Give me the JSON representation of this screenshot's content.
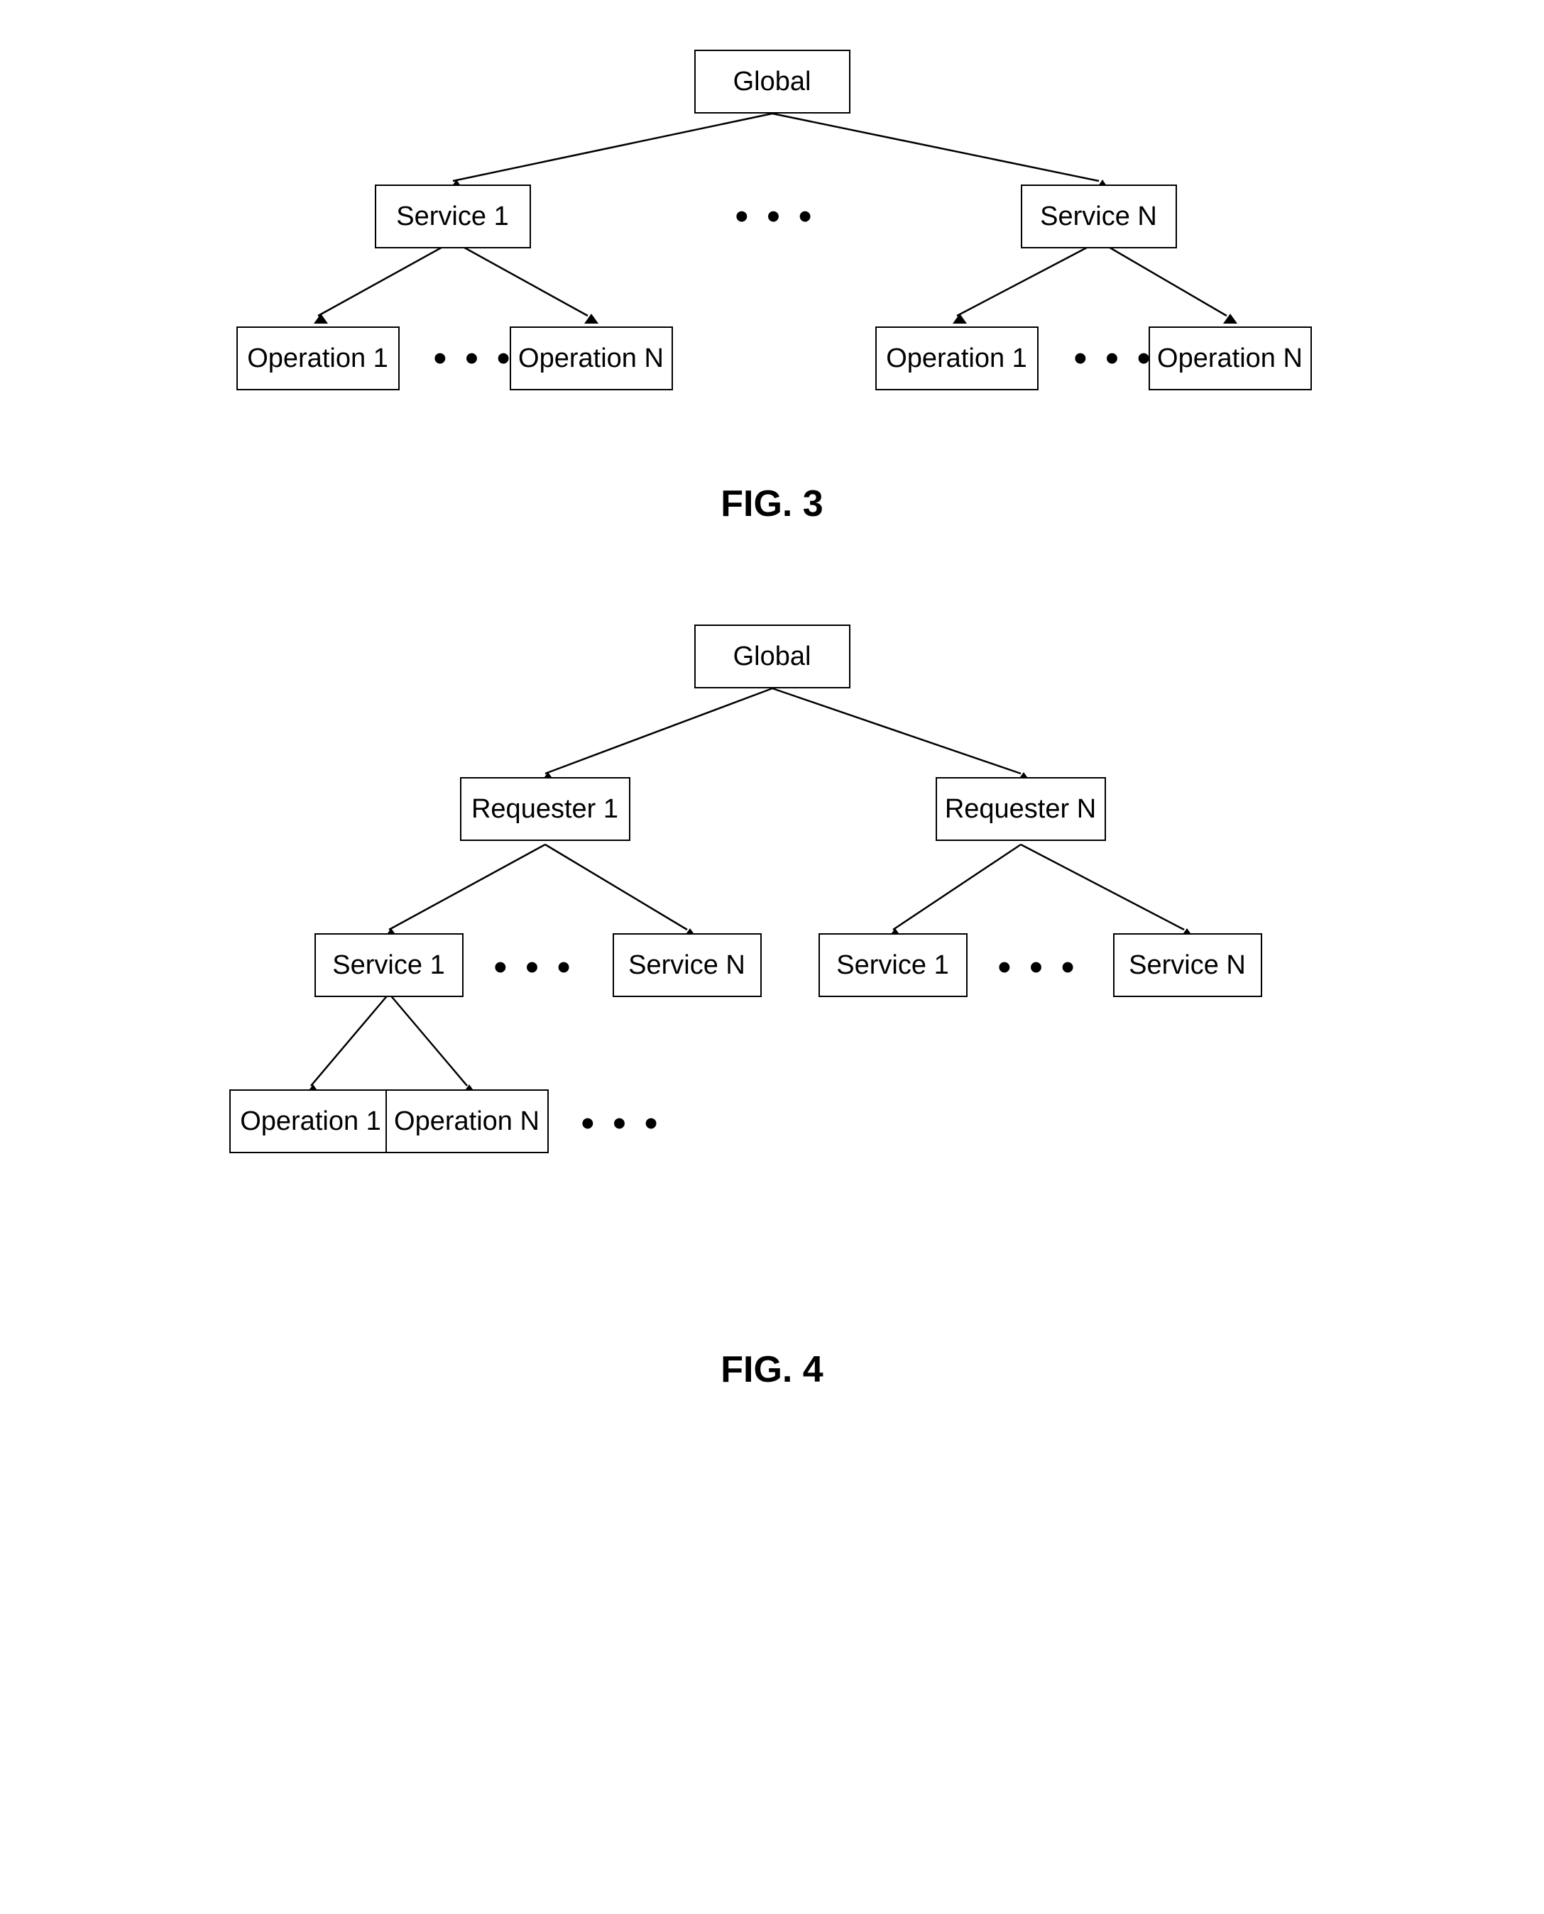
{
  "fig3": {
    "label": "FIG. 3",
    "nodes": {
      "global": {
        "text": "Global"
      },
      "service1": {
        "text": "Service 1"
      },
      "serviceN": {
        "text": "Service N"
      },
      "op1_left": {
        "text": "Operation 1"
      },
      "opN_left": {
        "text": "Operation N"
      },
      "op1_right": {
        "text": "Operation 1"
      },
      "opN_right": {
        "text": "Operation N"
      }
    },
    "dots": {
      "text": "• • •"
    }
  },
  "fig4": {
    "label": "FIG. 4",
    "nodes": {
      "global": {
        "text": "Global"
      },
      "requester1": {
        "text": "Requester 1"
      },
      "requesterN": {
        "text": "Requester N"
      },
      "service1_left": {
        "text": "Service 1"
      },
      "serviceN_left": {
        "text": "Service N"
      },
      "service1_right": {
        "text": "Service 1"
      },
      "serviceN_right": {
        "text": "Service N"
      },
      "op1": {
        "text": "Operation 1"
      },
      "opN": {
        "text": "Operation N"
      }
    },
    "dots": {
      "text": "• • •"
    }
  }
}
